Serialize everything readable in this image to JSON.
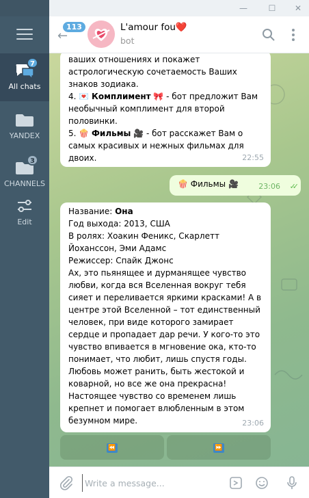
{
  "window": {
    "minimize": "—",
    "maximize": "☐",
    "close": "✕"
  },
  "sidebar": {
    "folders": [
      {
        "label": "All chats",
        "badge": "7"
      },
      {
        "label": "YANDEX",
        "badge": ""
      },
      {
        "label": "CHANNELS",
        "badge": "3"
      },
      {
        "label": "Edit",
        "badge": ""
      }
    ]
  },
  "header": {
    "unread_count": "113",
    "title": "L'amour fou❤️",
    "subtitle": "bot"
  },
  "messages": [
    {
      "direction": "in",
      "lines": [
        "ваших отношениях и покажет",
        "астрологическую сочетаемость Ваших",
        "знаков зодиака."
      ],
      "item4_num": "4. 💌 ",
      "item4_bold": "Комплимент",
      "item4_rest": " 🎀 - бот предложит Вам",
      "item4_cont": [
        "необычный комплимент для второй",
        "половинки."
      ],
      "item5_num": "5. 🍿 ",
      "item5_bold": "Фильмы",
      "item5_rest": " 🎥 - бот расскажет Вам о",
      "item5_cont": [
        "самых красивых и нежных фильмах для",
        "двоих."
      ],
      "time": "22:55"
    },
    {
      "direction": "out",
      "text": "🍿 Фильмы 🎥",
      "time": "23:06"
    },
    {
      "direction": "in",
      "name_label": "Название: ",
      "name_value": "Она",
      "lines": [
        "Год выхода: 2013, США",
        "В ролях: Хоакин Феникс, Скарлетт",
        "Йоханссон, Эми Адамс",
        "Режиссер: Спайк Джонс",
        "Ах, это пьянящее и дурманящее чувство",
        "любви, когда вся Вселенная вокруг тебя",
        "сияет и переливается яркими красками! А в",
        "центре этой Вселенной – тот единственный",
        "человек, при виде которого замирает",
        "сердце и пропадает дар речи. У кого-то это",
        "чувство впивается в мгновение ока, кто-то",
        "понимает, что любит, лишь спустя годы.",
        "Любовь может ранить, быть жестокой и",
        "коварной, но все же она прекрасна!",
        "Настоящее чувство со временем лишь",
        "крепнет и помогает влюбленным в этом",
        "безумном мире."
      ],
      "time": "23:06"
    }
  ],
  "inline_buttons": [
    {
      "label": "⏪"
    },
    {
      "label": "⏩"
    }
  ],
  "composer": {
    "placeholder": "Write a message..."
  },
  "colors": {
    "accent": "#5eabe0",
    "sidebar": "#425a6a",
    "outgoing": "#effdde"
  }
}
